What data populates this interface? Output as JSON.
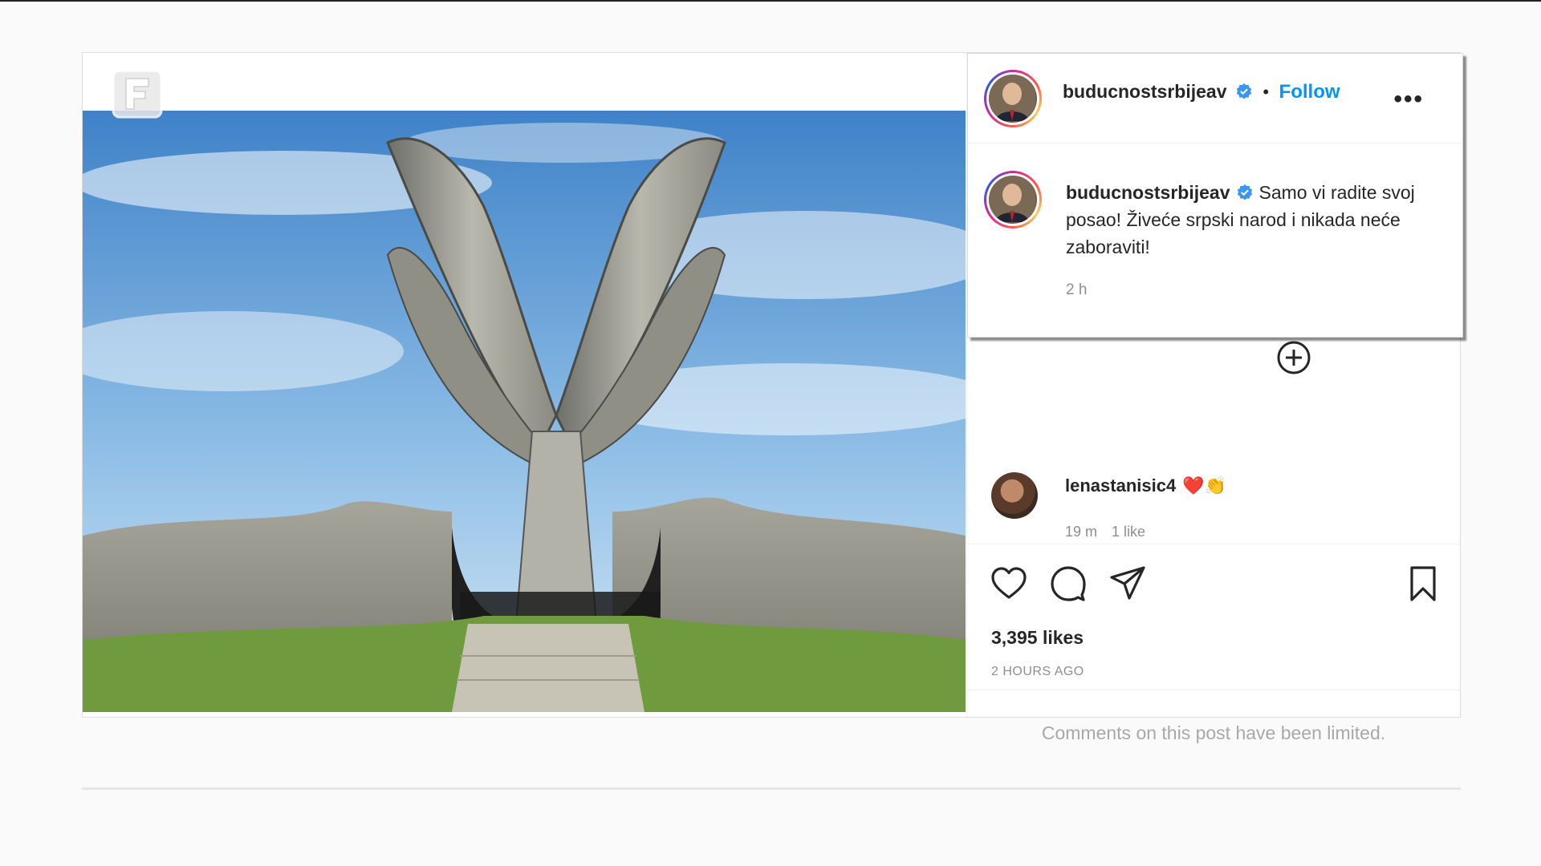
{
  "post": {
    "username": "buducnostsrbijeav",
    "follow_label": "Follow",
    "separator": "•",
    "more_label": "•••",
    "caption_username": "buducnostsrbijeav",
    "caption_text": "Samo vi radite svoj posao! Živeće srpski narod i nikada neće zaboraviti!",
    "caption_time": "2 h",
    "likes": "3,395 likes",
    "posted_ago": "2 HOURS AGO",
    "comments_limited": "Comments on this post have been limited."
  },
  "comment": {
    "username": "lenastanisic4",
    "emojis": "❤️👏",
    "time": "19 m",
    "likes": "1 like"
  },
  "colors": {
    "accent": "#0095f6",
    "text": "#262626",
    "muted": "#8e8e8e"
  },
  "icons": [
    "verified-badge-icon",
    "more-options-icon",
    "add-comment-plus-icon",
    "heart-icon",
    "comment-icon",
    "share-icon",
    "bookmark-icon",
    "channel-logo-icon"
  ]
}
